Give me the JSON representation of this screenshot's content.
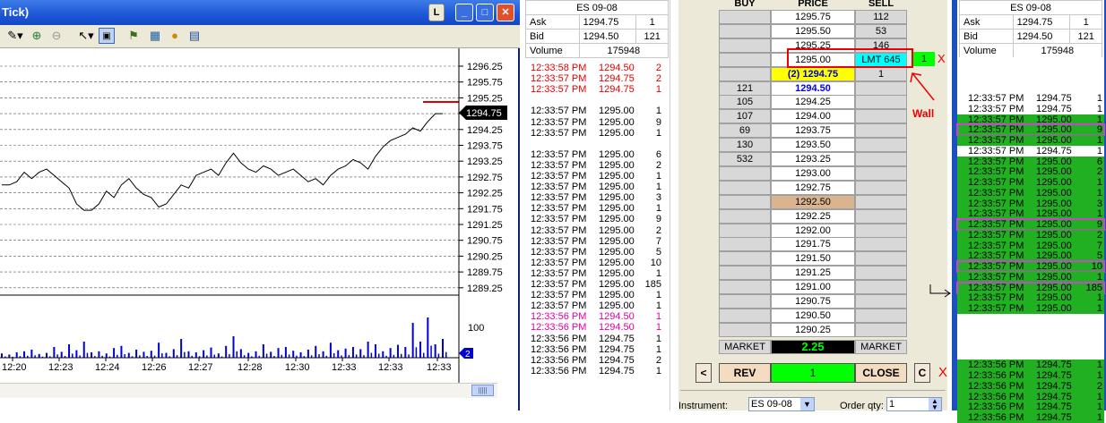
{
  "chart": {
    "title": "Tick)",
    "buttons": {
      "link": "L",
      "minimize": "_",
      "maximize": "□",
      "close": "✕"
    },
    "y_axis": [
      "1296.25",
      "1295.75",
      "1295.25",
      "1294.75",
      "1294.25",
      "1293.75",
      "1293.25",
      "1292.75",
      "1292.25",
      "1291.75",
      "1291.25",
      "1290.75",
      "1290.25",
      "1289.75",
      "1289.25"
    ],
    "last_price": "1294.75",
    "volume_label": "100",
    "volume_badge": "2",
    "x_axis": [
      "12:20",
      "12:23",
      "12:24",
      "12:26",
      "12:27",
      "12:28",
      "12:30",
      "12:33",
      "12:33",
      "12:33"
    ],
    "scroll": "|||||"
  },
  "chart_data": {
    "type": "line",
    "title": "",
    "ylim": [
      1289.0,
      1296.5
    ],
    "prices": [
      1292.5,
      1292.5,
      1292.6,
      1292.9,
      1292.7,
      1292.9,
      1293.0,
      1292.8,
      1292.6,
      1292.4,
      1291.9,
      1291.7,
      1291.7,
      1291.9,
      1292.3,
      1292.1,
      1292.5,
      1292.7,
      1292.4,
      1292.2,
      1292.1,
      1291.8,
      1291.9,
      1292.2,
      1292.5,
      1292.4,
      1292.8,
      1292.9,
      1293.0,
      1292.8,
      1293.2,
      1293.5,
      1293.2,
      1293.0,
      1292.9,
      1293.1,
      1293.0,
      1292.8,
      1292.9,
      1293.0,
      1292.8,
      1292.6,
      1292.7,
      1292.5,
      1292.8,
      1293.0,
      1293.1,
      1293.3,
      1293.2,
      1293.0,
      1293.4,
      1293.7,
      1293.9,
      1294.0,
      1294.1,
      1294.3,
      1294.2,
      1294.5,
      1294.75,
      1294.75
    ],
    "volume": [
      8,
      6,
      10,
      12,
      15,
      7,
      9,
      20,
      11,
      25,
      14,
      30,
      10,
      12,
      8,
      18,
      22,
      9,
      15,
      11,
      13,
      28,
      9,
      16,
      35,
      12,
      10,
      14,
      19,
      8,
      22,
      40,
      16,
      9,
      12,
      25,
      11,
      18,
      20,
      13,
      10,
      15,
      22,
      12,
      28,
      14,
      17,
      20,
      16,
      30,
      25,
      12,
      18,
      24,
      20,
      65,
      30,
      75,
      25,
      35
    ]
  },
  "ts_mid": {
    "quote": {
      "symbol": "ES 09-08",
      "ask_label": "Ask",
      "ask": "1294.75",
      "ask_size": "1",
      "bid_label": "Bid",
      "bid": "1294.50",
      "bid_size": "121",
      "vol_label": "Volume",
      "volume": "175948"
    },
    "rows": [
      {
        "t": "12:33:58 PM",
        "p": "1294.50",
        "q": "2",
        "c": "red"
      },
      {
        "t": "12:33:57 PM",
        "p": "1294.75",
        "q": "2",
        "c": "red"
      },
      {
        "t": "12:33:57 PM",
        "p": "1294.75",
        "q": "1",
        "c": "red"
      },
      {
        "t": "",
        "p": "",
        "q": "",
        "c": "blank"
      },
      {
        "t": "12:33:57 PM",
        "p": "1295.00",
        "q": "1",
        "c": "black"
      },
      {
        "t": "12:33:57 PM",
        "p": "1295.00",
        "q": "9",
        "c": "black"
      },
      {
        "t": "12:33:57 PM",
        "p": "1295.00",
        "q": "1",
        "c": "black"
      },
      {
        "t": "",
        "p": "",
        "q": "",
        "c": "blank"
      },
      {
        "t": "12:33:57 PM",
        "p": "1295.00",
        "q": "6",
        "c": "black"
      },
      {
        "t": "12:33:57 PM",
        "p": "1295.00",
        "q": "2",
        "c": "black"
      },
      {
        "t": "12:33:57 PM",
        "p": "1295.00",
        "q": "1",
        "c": "black"
      },
      {
        "t": "12:33:57 PM",
        "p": "1295.00",
        "q": "1",
        "c": "black"
      },
      {
        "t": "12:33:57 PM",
        "p": "1295.00",
        "q": "3",
        "c": "black"
      },
      {
        "t": "12:33:57 PM",
        "p": "1295.00",
        "q": "1",
        "c": "black"
      },
      {
        "t": "12:33:57 PM",
        "p": "1295.00",
        "q": "9",
        "c": "black"
      },
      {
        "t": "12:33:57 PM",
        "p": "1295.00",
        "q": "2",
        "c": "black"
      },
      {
        "t": "12:33:57 PM",
        "p": "1295.00",
        "q": "7",
        "c": "black"
      },
      {
        "t": "12:33:57 PM",
        "p": "1295.00",
        "q": "5",
        "c": "black"
      },
      {
        "t": "12:33:57 PM",
        "p": "1295.00",
        "q": "10",
        "c": "black"
      },
      {
        "t": "12:33:57 PM",
        "p": "1295.00",
        "q": "1",
        "c": "black"
      },
      {
        "t": "12:33:57 PM",
        "p": "1295.00",
        "q": "185",
        "c": "black"
      },
      {
        "t": "12:33:57 PM",
        "p": "1295.00",
        "q": "1",
        "c": "black"
      },
      {
        "t": "12:33:57 PM",
        "p": "1295.00",
        "q": "1",
        "c": "black"
      },
      {
        "t": "12:33:56 PM",
        "p": "1294.50",
        "q": "1",
        "c": "pink"
      },
      {
        "t": "12:33:56 PM",
        "p": "1294.50",
        "q": "1",
        "c": "pink"
      },
      {
        "t": "12:33:56 PM",
        "p": "1294.75",
        "q": "1",
        "c": "black"
      },
      {
        "t": "12:33:56 PM",
        "p": "1294.75",
        "q": "1",
        "c": "black"
      },
      {
        "t": "12:33:56 PM",
        "p": "1294.75",
        "q": "2",
        "c": "black"
      },
      {
        "t": "12:33:56 PM",
        "p": "1294.75",
        "q": "1",
        "c": "black"
      }
    ]
  },
  "dom": {
    "headers": {
      "buy": "BUY",
      "price": "PRICE",
      "sell": "SELL"
    },
    "rows": [
      {
        "buy": "",
        "price": "1295.75",
        "sell": "112"
      },
      {
        "buy": "",
        "price": "1295.50",
        "sell": "53"
      },
      {
        "buy": "",
        "price": "1295.25",
        "sell": "146"
      },
      {
        "buy": "",
        "price": "1295.00",
        "sell": "LMT 645"
      },
      {
        "buy": "",
        "price": "(2) 1294.75",
        "sell": "1"
      },
      {
        "buy": "121",
        "price": "1294.50",
        "sell": ""
      },
      {
        "buy": "105",
        "price": "1294.25",
        "sell": ""
      },
      {
        "buy": "107",
        "price": "1294.00",
        "sell": ""
      },
      {
        "buy": "69",
        "price": "1293.75",
        "sell": ""
      },
      {
        "buy": "130",
        "price": "1293.50",
        "sell": ""
      },
      {
        "buy": "532",
        "price": "1293.25",
        "sell": ""
      },
      {
        "buy": "",
        "price": "1293.00",
        "sell": ""
      },
      {
        "buy": "",
        "price": "1292.75",
        "sell": ""
      },
      {
        "buy": "",
        "price": "1292.50",
        "sell": ""
      },
      {
        "buy": "",
        "price": "1292.25",
        "sell": ""
      },
      {
        "buy": "",
        "price": "1292.00",
        "sell": ""
      },
      {
        "buy": "",
        "price": "1291.75",
        "sell": ""
      },
      {
        "buy": "",
        "price": "1291.50",
        "sell": ""
      },
      {
        "buy": "",
        "price": "1291.25",
        "sell": ""
      },
      {
        "buy": "",
        "price": "1291.00",
        "sell": ""
      },
      {
        "buy": "",
        "price": "1290.75",
        "sell": ""
      },
      {
        "buy": "",
        "price": "1290.50",
        "sell": ""
      },
      {
        "buy": "",
        "price": "1290.25",
        "sell": ""
      }
    ],
    "order_qty_badge": "1",
    "cancel_x": "X",
    "wall_label": "Wall",
    "market_buy": "MARKET",
    "pnl": "2.25",
    "market_sell": "MARKET",
    "lt": "<",
    "rev": "REV",
    "position": "1",
    "close": "CLOSE",
    "c": "C",
    "close_x": "X",
    "instrument_label": "Instrument:",
    "instrument": "ES 09-08",
    "order_qty_label": "Order qty:",
    "order_qty": "1",
    "colors": {
      "ask_bg": "#00ffff",
      "inside_bid": "#0000ff",
      "inside_ask_bg": "#ffff00",
      "pnl_bg": "#000000",
      "pnl_fg": "#00ff00",
      "pos_bg": "#00ff00",
      "annotation": "#ff0000",
      "highlight": "#cc44cc"
    }
  },
  "ts_right": {
    "quote": {
      "symbol": "ES 09-08",
      "ask_label": "Ask",
      "ask": "1294.75",
      "ask_size": "1",
      "bid_label": "Bid",
      "bid": "1294.50",
      "bid_size": "121",
      "vol_label": "Volume",
      "volume": "175948"
    },
    "rows": [
      {
        "t": "12:33:57 PM",
        "p": "1294.75",
        "q": "1",
        "g": false
      },
      {
        "t": "12:33:57 PM",
        "p": "1294.75",
        "q": "1",
        "g": false
      },
      {
        "t": "12:33:57 PM",
        "p": "1295.00",
        "q": "1",
        "g": true
      },
      {
        "t": "12:33:57 PM",
        "p": "1295.00",
        "q": "9",
        "g": true,
        "box": true
      },
      {
        "t": "12:33:57 PM",
        "p": "1295.00",
        "q": "1",
        "g": true
      },
      {
        "t": "12:33:57 PM",
        "p": "1294.75",
        "q": "1",
        "g": false
      },
      {
        "t": "12:33:57 PM",
        "p": "1295.00",
        "q": "6",
        "g": true
      },
      {
        "t": "12:33:57 PM",
        "p": "1295.00",
        "q": "2",
        "g": true
      },
      {
        "t": "12:33:57 PM",
        "p": "1295.00",
        "q": "1",
        "g": true
      },
      {
        "t": "12:33:57 PM",
        "p": "1295.00",
        "q": "1",
        "g": true
      },
      {
        "t": "12:33:57 PM",
        "p": "1295.00",
        "q": "3",
        "g": true
      },
      {
        "t": "12:33:57 PM",
        "p": "1295.00",
        "q": "1",
        "g": true
      },
      {
        "t": "12:33:57 PM",
        "p": "1295.00",
        "q": "9",
        "g": true,
        "box": true
      },
      {
        "t": "12:33:57 PM",
        "p": "1295.00",
        "q": "2",
        "g": true
      },
      {
        "t": "12:33:57 PM",
        "p": "1295.00",
        "q": "7",
        "g": true
      },
      {
        "t": "12:33:57 PM",
        "p": "1295.00",
        "q": "5",
        "g": true
      },
      {
        "t": "12:33:57 PM",
        "p": "1295.00",
        "q": "10",
        "g": true,
        "box": true
      },
      {
        "t": "12:33:57 PM",
        "p": "1295.00",
        "q": "1",
        "g": true
      },
      {
        "t": "12:33:57 PM",
        "p": "1295.00",
        "q": "185",
        "g": true,
        "box": true
      },
      {
        "t": "12:33:57 PM",
        "p": "1295.00",
        "q": "1",
        "g": true
      },
      {
        "t": "12:33:57 PM",
        "p": "1295.00",
        "q": "1",
        "g": true
      },
      {
        "t": "",
        "p": "",
        "q": "",
        "g": false,
        "blank": true
      },
      {
        "t": "",
        "p": "",
        "q": "",
        "g": false,
        "blank": true
      },
      {
        "t": "12:33:56 PM",
        "p": "1294.75",
        "q": "1",
        "g": true
      },
      {
        "t": "12:33:56 PM",
        "p": "1294.75",
        "q": "1",
        "g": true
      },
      {
        "t": "12:33:56 PM",
        "p": "1294.75",
        "q": "2",
        "g": true
      },
      {
        "t": "12:33:56 PM",
        "p": "1294.75",
        "q": "1",
        "g": true
      },
      {
        "t": "12:33:56 PM",
        "p": "1294.75",
        "q": "1",
        "g": true
      },
      {
        "t": "12:33:56 PM",
        "p": "1294.75",
        "q": "1",
        "g": true
      }
    ]
  }
}
